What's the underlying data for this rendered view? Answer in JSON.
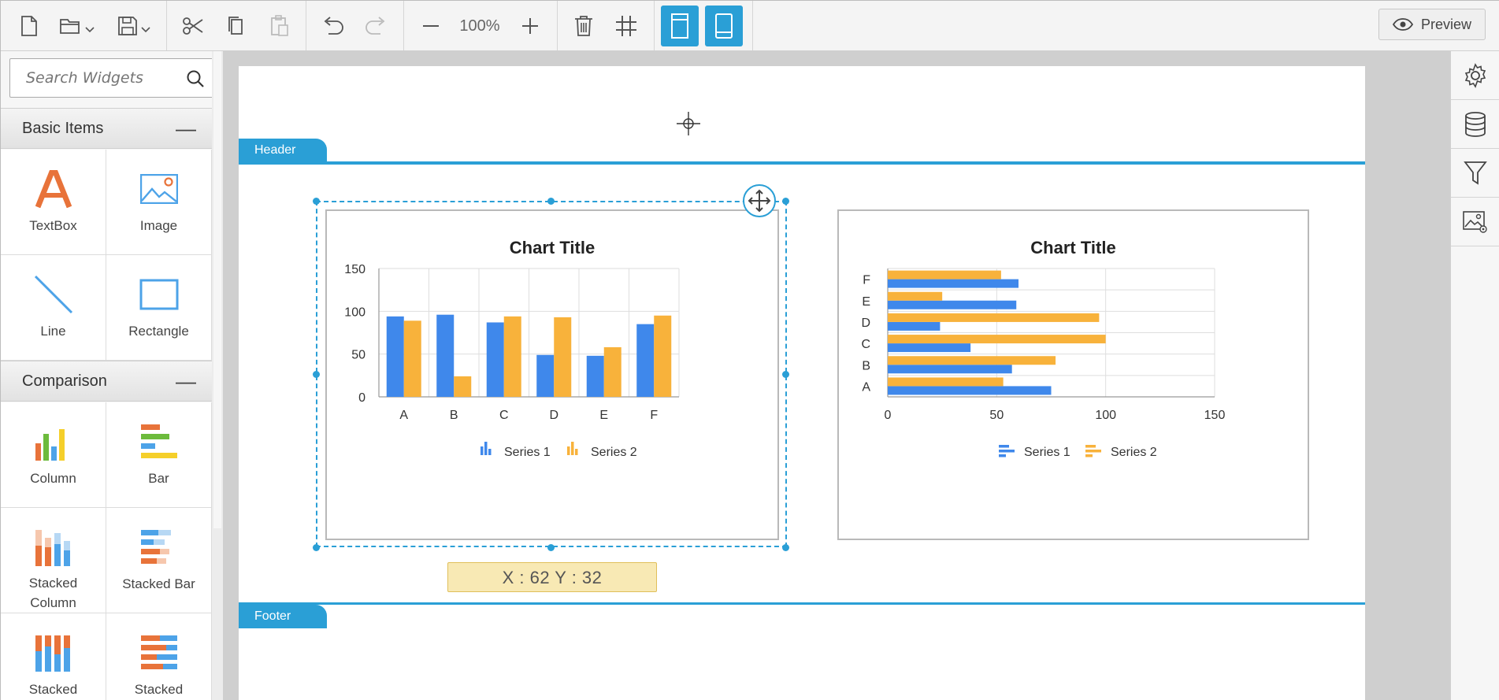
{
  "toolbar": {
    "zoom_level": "100%",
    "preview_label": "Preview"
  },
  "search": {
    "placeholder": "Search Widgets"
  },
  "sidebar": {
    "sections": [
      {
        "title": "Basic Items",
        "widgets": [
          {
            "label": "TextBox",
            "icon": "textbox-icon"
          },
          {
            "label": "Image",
            "icon": "image-icon"
          },
          {
            "label": "Line",
            "icon": "line-icon"
          },
          {
            "label": "Rectangle",
            "icon": "rectangle-icon"
          }
        ]
      },
      {
        "title": "Comparison",
        "widgets": [
          {
            "label": "Column",
            "icon": "column-chart-icon"
          },
          {
            "label": "Bar",
            "icon": "bar-chart-icon"
          },
          {
            "label": "Stacked Column",
            "icon": "stacked-column-icon"
          },
          {
            "label": "Stacked Bar",
            "icon": "stacked-bar-icon"
          },
          {
            "label": "Stacked",
            "icon": "stacked-100-column-icon"
          },
          {
            "label": "Stacked",
            "icon": "stacked-100-bar-icon"
          }
        ]
      }
    ]
  },
  "report": {
    "header_label": "Header",
    "footer_label": "Footer",
    "coordinates": "X : 62  Y : 32"
  },
  "colors": {
    "accent": "#2a9fd6",
    "series1": "#3f88eb",
    "series2": "#f8b23b",
    "coord_tip_bg": "#f8e9b4"
  },
  "right_panel": {
    "buttons": [
      "settings-icon",
      "database-icon",
      "filter-icon",
      "image-settings-icon"
    ]
  },
  "chart_data": [
    {
      "type": "bar",
      "orientation": "vertical",
      "title": "Chart Title",
      "categories": [
        "A",
        "B",
        "C",
        "D",
        "E",
        "F"
      ],
      "series": [
        {
          "name": "Series 1",
          "values": [
            94,
            96,
            87,
            49,
            48,
            85
          ]
        },
        {
          "name": "Series 2",
          "values": [
            89,
            24,
            94,
            93,
            58,
            95
          ]
        }
      ],
      "ylim": [
        0,
        150
      ],
      "yticks": [
        0,
        50,
        100,
        150
      ],
      "grid": true,
      "legend": "bottom"
    },
    {
      "type": "bar",
      "orientation": "horizontal",
      "title": "Chart Title",
      "categories": [
        "A",
        "B",
        "C",
        "D",
        "E",
        "F"
      ],
      "series": [
        {
          "name": "Series 1",
          "values": [
            75,
            57,
            38,
            24,
            59,
            60
          ]
        },
        {
          "name": "Series 2",
          "values": [
            53,
            77,
            100,
            97,
            25,
            52
          ]
        }
      ],
      "xlim": [
        0,
        150
      ],
      "xticks": [
        0,
        50,
        100,
        150
      ],
      "grid": true,
      "legend": "bottom"
    }
  ]
}
